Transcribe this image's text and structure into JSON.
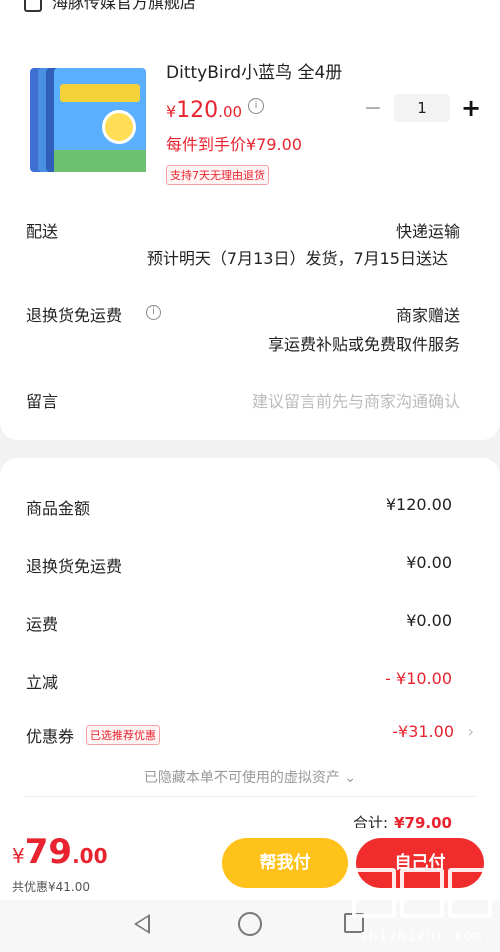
{
  "store": {
    "name": "海豚传媒官方旗舰店"
  },
  "product": {
    "title": "DittyBird小蓝鸟 全4册",
    "price_symbol": "¥",
    "price_int": "120",
    "price_dec": ".00",
    "promo_price": "每件到手价¥79.00",
    "return_tag": "支持7天无理由退货",
    "quantity": "1",
    "minus": "−",
    "plus": "+"
  },
  "shipping": {
    "label": "配送",
    "method": "快递运输",
    "estimate": "预计明天（7月13日）发货，7月15日送达"
  },
  "return_insurance": {
    "label": "退换货免运费",
    "value": "商家赠送",
    "detail": "享运费补贴或免费取件服务"
  },
  "message": {
    "label": "留言",
    "placeholder": "建议留言前先与商家沟通确认"
  },
  "summary": {
    "goods_label": "商品金额",
    "goods_value": "¥120.00",
    "return_label": "退换货免运费",
    "return_value": "¥0.00",
    "freight_label": "运费",
    "freight_value": "¥0.00",
    "discount_label": "立减",
    "discount_value": "- ¥10.00",
    "coupon_label": "优惠券",
    "coupon_tag": "已选推荐优惠",
    "coupon_value": "-¥31.00",
    "hidden_assets": "已隐藏本单不可使用的虚拟资产 ⌄",
    "total_label": "合计:",
    "total_value": "¥79.00"
  },
  "bottom": {
    "pay_symbol": "¥",
    "pay_int": "79",
    "pay_dec": ".00",
    "saved": "共优惠¥41.00",
    "help_pay": "帮我付",
    "self_pay": "自己付"
  },
  "watermark": {
    "text": "zhizhizhi.com"
  },
  "colors": {
    "accent": "#e8232f",
    "help_button": "#ffc21a",
    "pay_button": "#f02c2c"
  }
}
